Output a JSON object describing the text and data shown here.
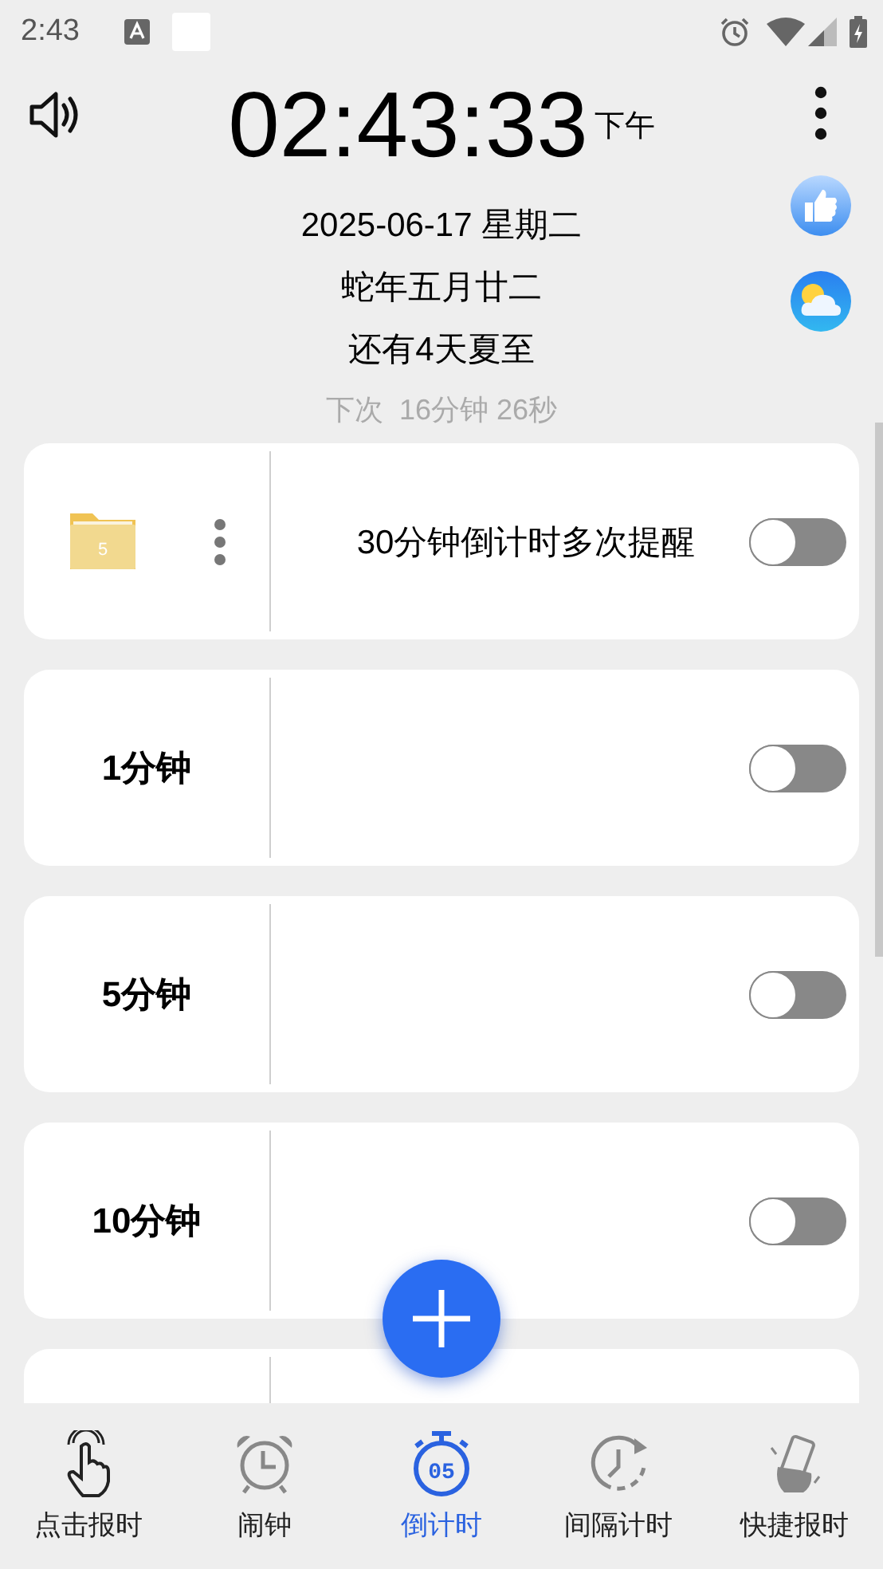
{
  "status_bar": {
    "time": "2:43"
  },
  "clock": {
    "time": "02:43:33",
    "period": "下午",
    "date": "2025-06-17 星期二",
    "lunar": "蛇年五月廿二",
    "solar_term": "还有4天夏至",
    "next": "下次  16分钟 26秒"
  },
  "timers": [
    {
      "kind": "folder",
      "count": "5",
      "title": "30分钟倒计时多次提醒",
      "on": false
    },
    {
      "kind": "timer",
      "label": "1分钟",
      "on": false
    },
    {
      "kind": "timer",
      "label": "5分钟",
      "on": false
    },
    {
      "kind": "timer",
      "label": "10分钟",
      "on": false
    },
    {
      "kind": "partial"
    }
  ],
  "nav": [
    {
      "kind": "tap",
      "label": "点击报时",
      "selected": false
    },
    {
      "kind": "alarm",
      "label": "闹钟",
      "selected": false
    },
    {
      "kind": "countdown",
      "label": "倒计时",
      "badge": "05",
      "selected": true
    },
    {
      "kind": "interval",
      "label": "间隔计时",
      "selected": false
    },
    {
      "kind": "shake",
      "label": "快捷报时",
      "selected": false
    }
  ]
}
